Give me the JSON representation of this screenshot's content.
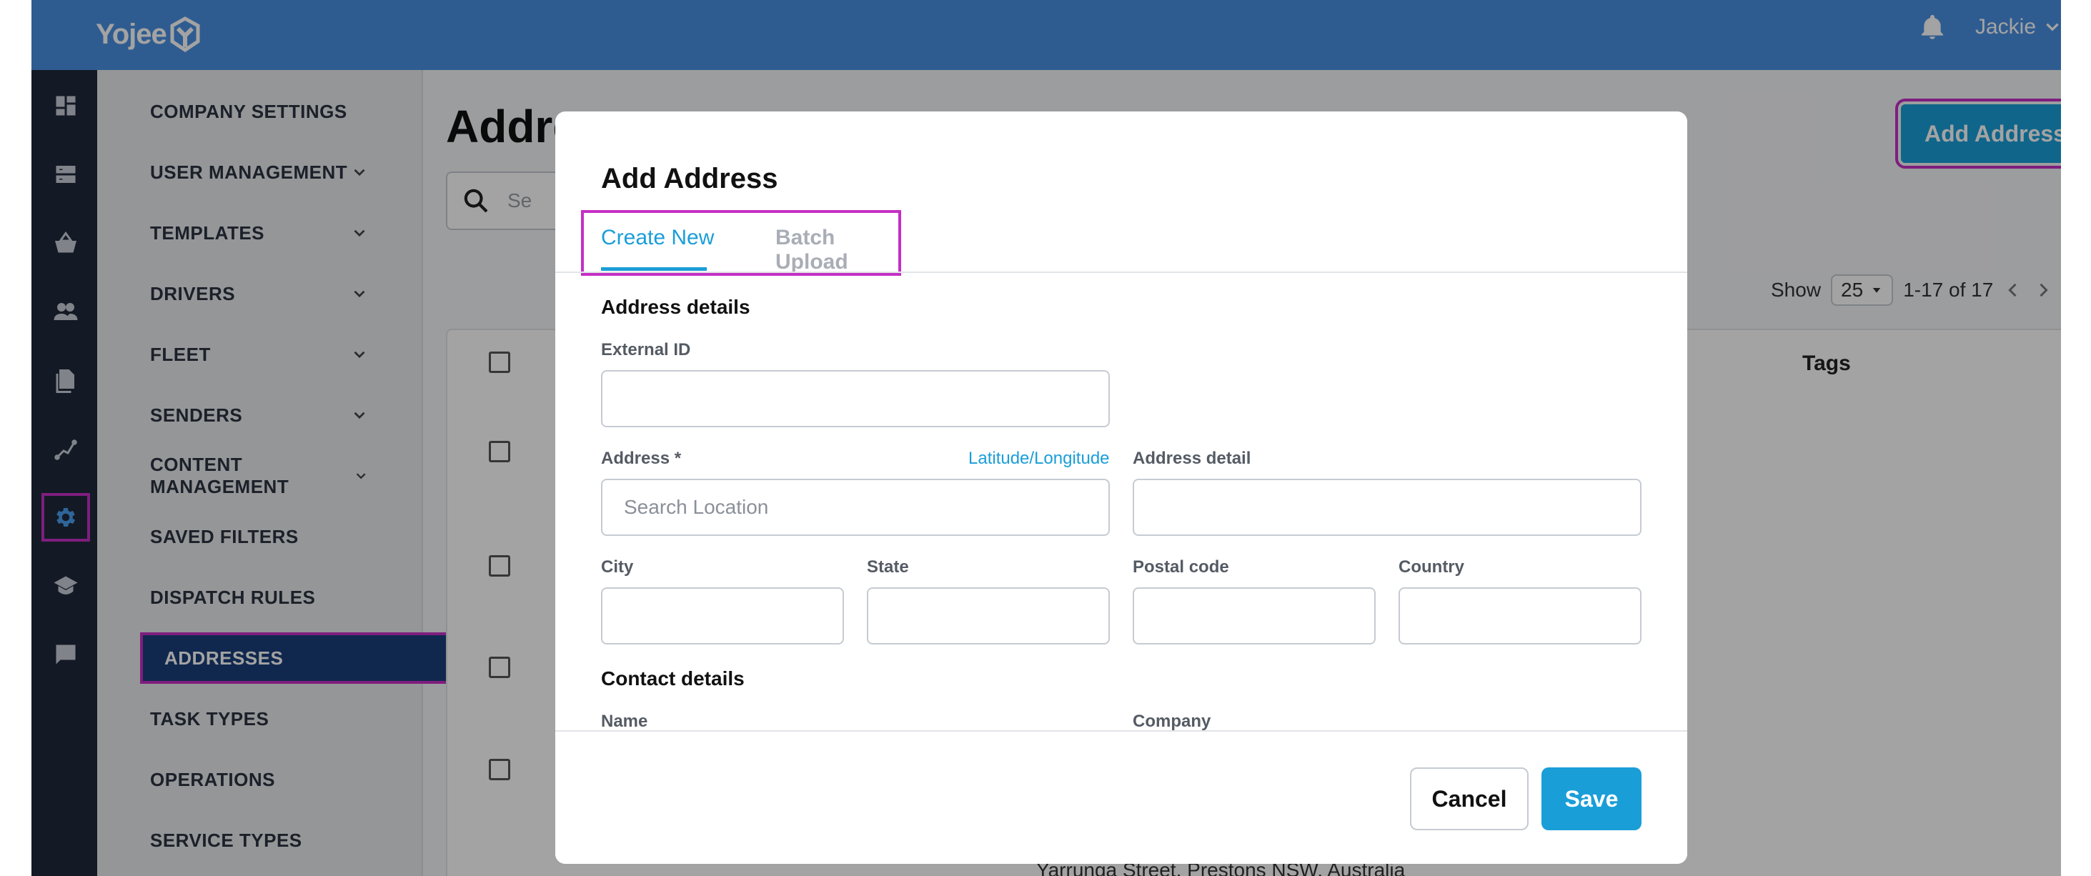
{
  "app": {
    "brand": "Yojee",
    "user": "Jackie",
    "colors": {
      "topbar": "#4a90e2",
      "rail": "#1f2a3a",
      "accent": "#1a9ed8",
      "highlight": "#c52fc5",
      "active_nav": "#1a3f7a"
    }
  },
  "rail": {
    "icons": [
      "dashboard-icon",
      "list-view-icon",
      "basket-icon",
      "people-icon",
      "documents-icon",
      "map-route-icon",
      "gear-icon",
      "school-icon",
      "chat-icon"
    ],
    "active": "gear-icon"
  },
  "sidebar": {
    "items": [
      {
        "label": "COMPANY SETTINGS",
        "chevron": false
      },
      {
        "label": "USER MANAGEMENT",
        "chevron": true
      },
      {
        "label": "TEMPLATES",
        "chevron": true
      },
      {
        "label": "DRIVERS",
        "chevron": true
      },
      {
        "label": "FLEET",
        "chevron": true
      },
      {
        "label": "SENDERS",
        "chevron": true
      },
      {
        "label": "CONTENT MANAGEMENT",
        "chevron": true
      },
      {
        "label": "SAVED FILTERS",
        "chevron": false
      },
      {
        "label": "DISPATCH RULES",
        "chevron": false
      },
      {
        "label": "ADDRESSES",
        "chevron": false,
        "active": true
      },
      {
        "label": "TASK TYPES",
        "chevron": false
      },
      {
        "label": "OPERATIONS",
        "chevron": false
      },
      {
        "label": "SERVICE TYPES",
        "chevron": false
      }
    ]
  },
  "main": {
    "title": "Addre",
    "search_placeholder": "Se",
    "add_button": "Add Address",
    "pager": {
      "show_label": "Show",
      "page_size": "25",
      "range": "1-17 of 17"
    },
    "table": {
      "tags_header": "Tags",
      "visible_row_text": "Yarrunga Street, Prestons NSW, Australia"
    }
  },
  "modal": {
    "title": "Add Address",
    "tabs": [
      {
        "label": "Create New",
        "active": true
      },
      {
        "label": "Batch Upload",
        "active": false
      }
    ],
    "address_section": "Address details",
    "fields": {
      "external_id": {
        "label": "External ID",
        "value": ""
      },
      "address": {
        "label": "Address *",
        "placeholder": "Search Location",
        "link": "Latitude/Longitude"
      },
      "address_detail": {
        "label": "Address detail",
        "value": ""
      },
      "city": {
        "label": "City",
        "value": ""
      },
      "state": {
        "label": "State",
        "value": ""
      },
      "postal_code": {
        "label": "Postal code",
        "value": ""
      },
      "country": {
        "label": "Country",
        "value": ""
      }
    },
    "contact_section": "Contact details",
    "contact_fields": {
      "name": "Name",
      "company": "Company"
    },
    "buttons": {
      "cancel": "Cancel",
      "save": "Save"
    }
  }
}
